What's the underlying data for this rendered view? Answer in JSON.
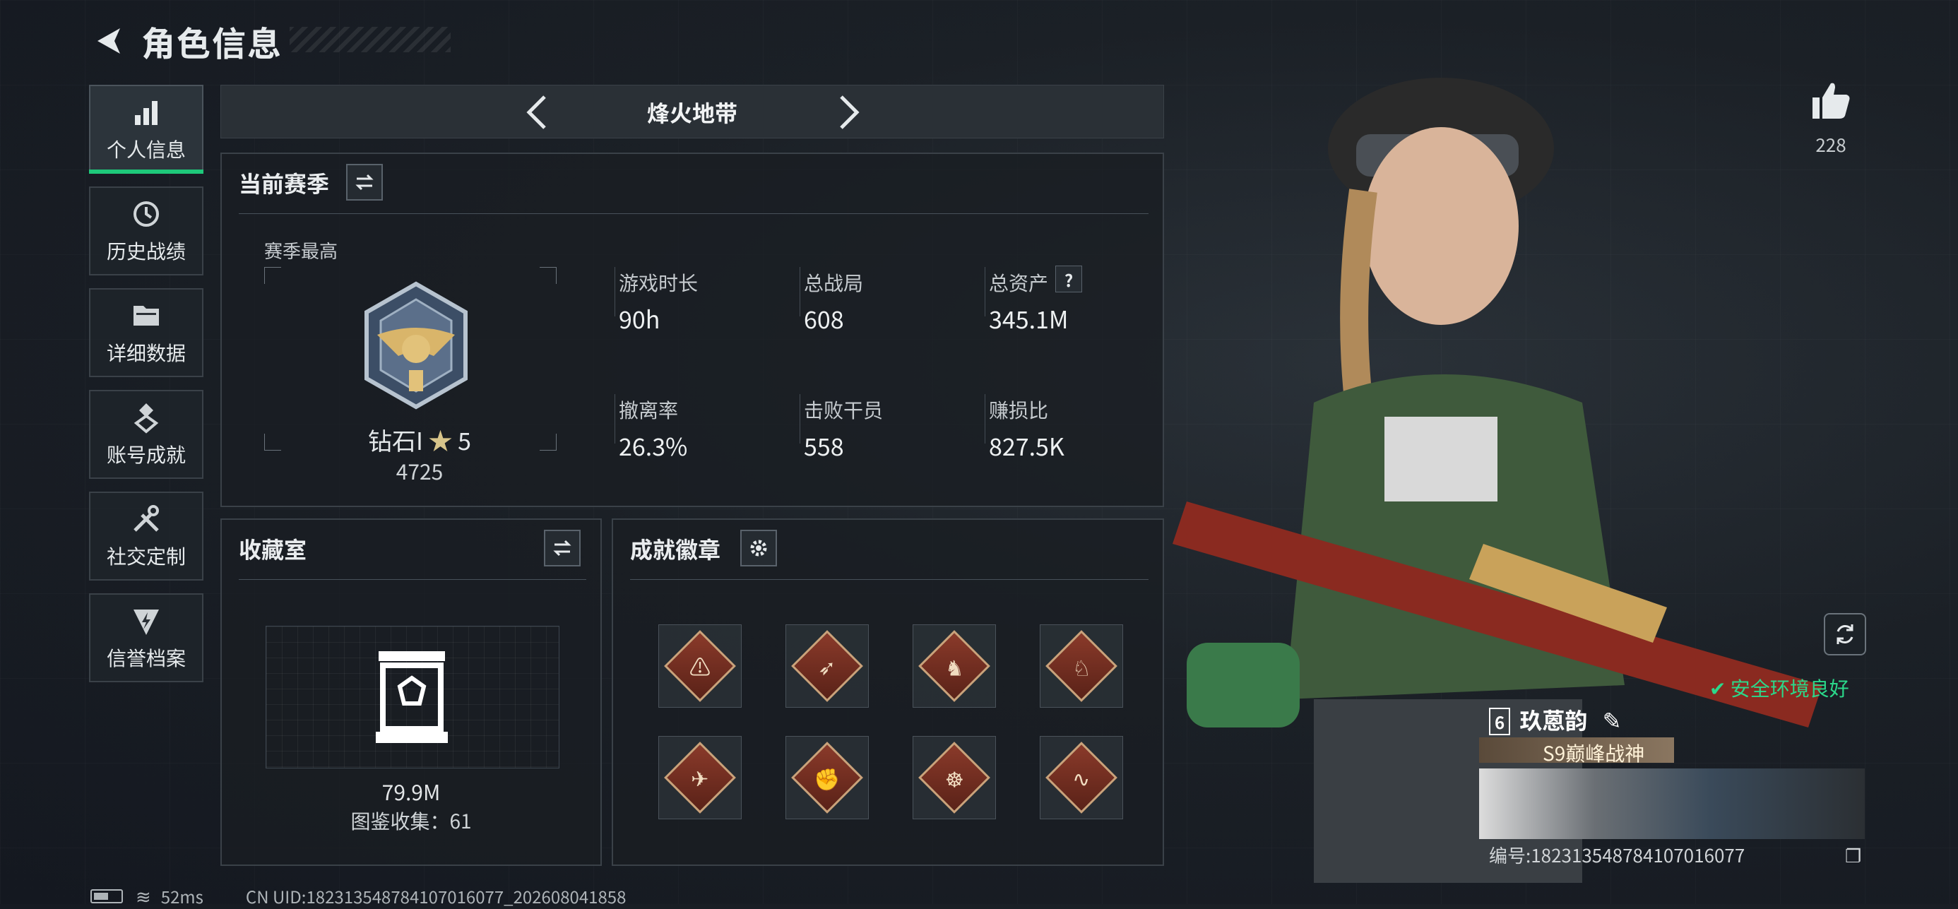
{
  "header": {
    "title": "角色信息"
  },
  "sidebar": {
    "items": [
      {
        "label": "个人信息",
        "icon": "bar-chart-icon",
        "active": true
      },
      {
        "label": "历史战绩",
        "icon": "history-icon"
      },
      {
        "label": "详细数据",
        "icon": "folder-icon"
      },
      {
        "label": "账号成就",
        "icon": "achievement-icon"
      },
      {
        "label": "社交定制",
        "icon": "tools-icon"
      },
      {
        "label": "信誉档案",
        "icon": "shield-bolt-icon"
      }
    ]
  },
  "mode": {
    "title": "烽火地带"
  },
  "season": {
    "title": "当前赛季",
    "best_label": "赛季最高",
    "rank_name": "钻石I",
    "rank_stars": "5",
    "rank_points": "4725",
    "stats": [
      {
        "label": "游戏时长",
        "value": "90h"
      },
      {
        "label": "总战局",
        "value": "608"
      },
      {
        "label": "总资产",
        "value": "345.1M"
      },
      {
        "label": "撤离率",
        "value": "26.3%"
      },
      {
        "label": "击败干员",
        "value": "558"
      },
      {
        "label": "赚损比",
        "value": "827.5K"
      }
    ]
  },
  "collection": {
    "title": "收藏室",
    "value": "79.9M",
    "count_text": "图鉴收集：61"
  },
  "badges": {
    "title": "成就徽章",
    "items": [
      "warning-badge",
      "runner-badge",
      "dragon-badge",
      "wolf-badge",
      "jet-badge",
      "fist-badge",
      "wheel-badge",
      "snake-badge"
    ]
  },
  "social": {
    "likes": "228"
  },
  "environment": {
    "status": "安全环境良好"
  },
  "player": {
    "name": "玖蒽韵",
    "level": "6",
    "title": "S9巅峰战神",
    "id_text": "编号:182313548784107016077"
  },
  "statusbar": {
    "ping": "52ms",
    "uid_text": "CN UID:182313548784107016077_202608041858"
  },
  "colors": {
    "accent_green": "#1ec87a",
    "safe_green": "#2bd88a"
  }
}
